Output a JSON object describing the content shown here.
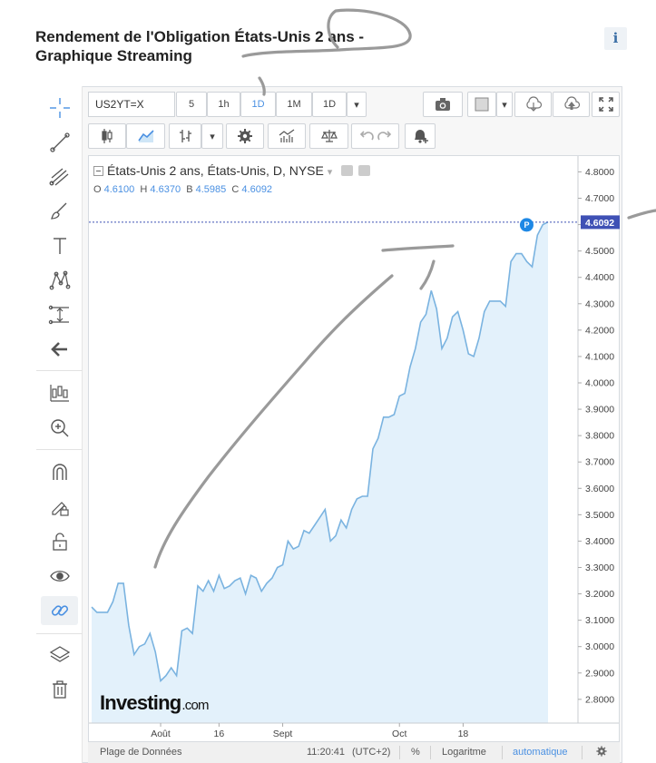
{
  "page": {
    "title": "Rendement de l'Obligation États-Unis 2 ans - Graphique Streaming",
    "info_label": "i"
  },
  "toolbar": {
    "symbol": "US2YT=X",
    "intervals": [
      "5",
      "1h",
      "1D",
      "1M",
      "1D"
    ],
    "selected_interval": "1D",
    "dropdown_glyph": "▾"
  },
  "legend": {
    "title": "États-Unis 2 ans, États-Unis, D, NYSE",
    "open_label": "O",
    "open": "4.6100",
    "high_label": "H",
    "high": "4.6370",
    "low_label": "B",
    "low": "4.5985",
    "close_label": "C",
    "close": "4.6092"
  },
  "status": {
    "data_range": "Plage de Données",
    "time": "11:20:41",
    "timezone": "(UTC+2)",
    "percent": "%",
    "log": "Logaritme",
    "auto": "automatique"
  },
  "watermark": {
    "brand": "Investing",
    "suffix": ".com"
  },
  "colors": {
    "line": "#7ab3e0",
    "area": "#e3f1fb",
    "price_tag": "#3f51b5",
    "accent": "#4a90e2"
  },
  "chart_data": {
    "type": "area",
    "title": "",
    "xlabel": "",
    "ylabel": "",
    "y_ticks": [
      "4.8000",
      "4.7000",
      "4.6000",
      "4.5000",
      "4.4000",
      "4.3000",
      "4.2000",
      "4.1000",
      "4.0000",
      "3.9000",
      "3.8000",
      "3.7000",
      "3.6000",
      "3.5000",
      "3.4000",
      "3.3000",
      "3.2000",
      "3.1000",
      "3.0000",
      "2.9000",
      "2.8000"
    ],
    "x_tick_labels": [
      "Août",
      "16",
      "Sept",
      "Oct",
      "18"
    ],
    "x_tick_index": [
      13,
      24,
      36,
      58,
      70
    ],
    "ylim": [
      2.71,
      4.86
    ],
    "last_value_label": "4.6092",
    "last_value": 4.6092,
    "marker_label": "P",
    "values": [
      3.15,
      3.13,
      3.13,
      3.13,
      3.17,
      3.24,
      3.24,
      3.08,
      2.97,
      3.0,
      3.01,
      3.05,
      2.98,
      2.87,
      2.89,
      2.92,
      2.89,
      3.06,
      3.07,
      3.05,
      3.23,
      3.21,
      3.25,
      3.21,
      3.27,
      3.22,
      3.23,
      3.25,
      3.26,
      3.2,
      3.27,
      3.26,
      3.21,
      3.24,
      3.26,
      3.3,
      3.31,
      3.4,
      3.37,
      3.38,
      3.44,
      3.43,
      3.46,
      3.49,
      3.52,
      3.4,
      3.42,
      3.48,
      3.45,
      3.52,
      3.56,
      3.57,
      3.57,
      3.75,
      3.79,
      3.87,
      3.87,
      3.88,
      3.95,
      3.96,
      4.06,
      4.13,
      4.23,
      4.26,
      4.35,
      4.28,
      4.13,
      4.17,
      4.25,
      4.27,
      4.2,
      4.11,
      4.1,
      4.17,
      4.27,
      4.31,
      4.31,
      4.31,
      4.29,
      4.46,
      4.49,
      4.49,
      4.46,
      4.44,
      4.56,
      4.6,
      4.61
    ]
  }
}
